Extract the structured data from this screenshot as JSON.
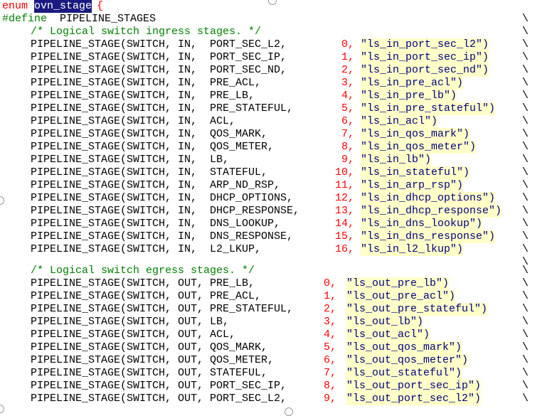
{
  "enum_line": {
    "keyword": "enum",
    "name": "ovn_stage",
    "brace": "{"
  },
  "define_line": {
    "directive": "#define",
    "macro": "PIPELINE_STAGES"
  },
  "ingress_comment": "/* Logical switch ingress stages. */",
  "ingress": [
    {
      "head": "PIPELINE_STAGE(SWITCH, IN,  PORT_SEC_L2,",
      "num": "0,",
      "str": "\"ls_in_port_sec_l2\")"
    },
    {
      "head": "PIPELINE_STAGE(SWITCH, IN,  PORT_SEC_IP,",
      "num": "1,",
      "str": "\"ls_in_port_sec_ip\")"
    },
    {
      "head": "PIPELINE_STAGE(SWITCH, IN,  PORT_SEC_ND,",
      "num": "2,",
      "str": "\"ls_in_port_sec_nd\")"
    },
    {
      "head": "PIPELINE_STAGE(SWITCH, IN,  PRE_ACL,",
      "num": "3,",
      "str": "\"ls_in_pre_acl\")"
    },
    {
      "head": "PIPELINE_STAGE(SWITCH, IN,  PRE_LB,",
      "num": "4,",
      "str": "\"ls_in_pre_lb\")"
    },
    {
      "head": "PIPELINE_STAGE(SWITCH, IN,  PRE_STATEFUL,",
      "num": "5,",
      "str": "\"ls_in_pre_stateful\")"
    },
    {
      "head": "PIPELINE_STAGE(SWITCH, IN,  ACL,",
      "num": "6,",
      "str": "\"ls_in_acl\")"
    },
    {
      "head": "PIPELINE_STAGE(SWITCH, IN,  QOS_MARK,",
      "num": "7,",
      "str": "\"ls_in_qos_mark\")"
    },
    {
      "head": "PIPELINE_STAGE(SWITCH, IN,  QOS_METER,",
      "num": "8,",
      "str": "\"ls_in_qos_meter\")"
    },
    {
      "head": "PIPELINE_STAGE(SWITCH, IN,  LB,",
      "num": "9,",
      "str": "\"ls_in_lb\")"
    },
    {
      "head": "PIPELINE_STAGE(SWITCH, IN,  STATEFUL,",
      "num": "10,",
      "str": "\"ls_in_stateful\")"
    },
    {
      "head": "PIPELINE_STAGE(SWITCH, IN,  ARP_ND_RSP,",
      "num": "11,",
      "str": "\"ls_in_arp_rsp\")"
    },
    {
      "head": "PIPELINE_STAGE(SWITCH, IN,  DHCP_OPTIONS,",
      "num": "12,",
      "str": "\"ls_in_dhcp_options\")"
    },
    {
      "head": "PIPELINE_STAGE(SWITCH, IN,  DHCP_RESPONSE,",
      "num": "13,",
      "str": "\"ls_in_dhcp_response\")"
    },
    {
      "head": "PIPELINE_STAGE(SWITCH, IN,  DNS_LOOKUP,",
      "num": "14,",
      "str": "\"ls_in_dns_lookup\")"
    },
    {
      "head": "PIPELINE_STAGE(SWITCH, IN,  DNS_RESPONSE,",
      "num": "15,",
      "str": "\"ls_in_dns_response\")"
    },
    {
      "head": "PIPELINE_STAGE(SWITCH, IN,  L2_LKUP,",
      "num": "16,",
      "str": "\"ls_in_l2_lkup\")"
    }
  ],
  "egress_comment": "/* Logical switch egress stages. */",
  "egress": [
    {
      "head": "PIPELINE_STAGE(SWITCH, OUT, PRE_LB,",
      "num": "0,",
      "str": "\"ls_out_pre_lb\")"
    },
    {
      "head": "PIPELINE_STAGE(SWITCH, OUT, PRE_ACL,",
      "num": "1,",
      "str": "\"ls_out_pre_acl\")"
    },
    {
      "head": "PIPELINE_STAGE(SWITCH, OUT, PRE_STATEFUL,",
      "num": "2,",
      "str": "\"ls_out_pre_stateful\")"
    },
    {
      "head": "PIPELINE_STAGE(SWITCH, OUT, LB,",
      "num": "3,",
      "str": "\"ls_out_lb\")"
    },
    {
      "head": "PIPELINE_STAGE(SWITCH, OUT, ACL,",
      "num": "4,",
      "str": "\"ls_out_acl\")"
    },
    {
      "head": "PIPELINE_STAGE(SWITCH, OUT, QOS_MARK,",
      "num": "5,",
      "str": "\"ls_out_qos_mark\")"
    },
    {
      "head": "PIPELINE_STAGE(SWITCH, OUT, QOS_METER,",
      "num": "6,",
      "str": "\"ls_out_qos_meter\")"
    },
    {
      "head": "PIPELINE_STAGE(SWITCH, OUT, STATEFUL,",
      "num": "7,",
      "str": "\"ls_out_stateful\")"
    },
    {
      "head": "PIPELINE_STAGE(SWITCH, OUT, PORT_SEC_IP,",
      "num": "8,",
      "str": "\"ls_out_port_sec_ip\")"
    },
    {
      "head": "PIPELINE_STAGE(SWITCH, OUT, PORT_SEC_L2,",
      "num": "9,",
      "str": "\"ls_out_port_sec_l2\")"
    }
  ],
  "continuation": "\\",
  "colors": {
    "number": "#ff0000",
    "string_bg": "#ffffc8",
    "comment": "#008000",
    "selection_bg": "#1a1a80"
  }
}
